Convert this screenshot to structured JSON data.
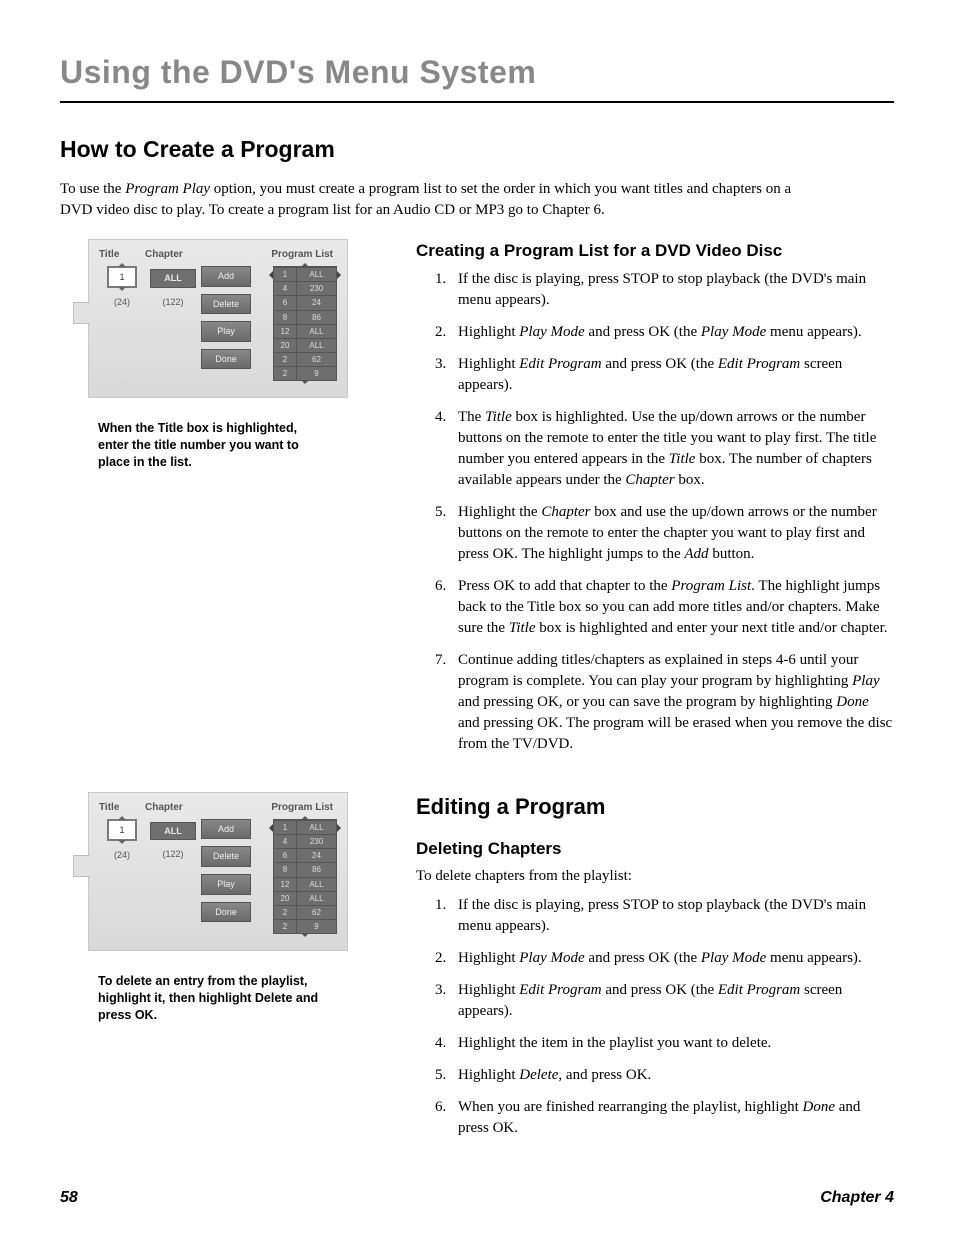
{
  "chapter_header": "Using the DVD's Menu System",
  "section1": {
    "heading": "How to Create a Program",
    "intro_parts": {
      "p1": "To use the ",
      "i1": "Program Play",
      "p2": " option, you must create a program list to set the order in which you want titles and chapters on a DVD video disc to play. To create a program list for an Audio CD or MP3 go to Chapter 6."
    },
    "screenshot": {
      "labels": {
        "title": "Title",
        "chapter": "Chapter",
        "program_list": "Program List"
      },
      "title_value": "1",
      "title_count": "(24)",
      "chapter_chip": "ALL",
      "chapter_count": "(122)",
      "buttons": [
        "Add",
        "Delete",
        "Play",
        "Done"
      ],
      "rows": [
        {
          "a": "1",
          "b": "ALL"
        },
        {
          "a": "4",
          "b": "230"
        },
        {
          "a": "6",
          "b": "24"
        },
        {
          "a": "8",
          "b": "86"
        },
        {
          "a": "12",
          "b": "ALL"
        },
        {
          "a": "20",
          "b": "ALL"
        },
        {
          "a": "2",
          "b": "62"
        },
        {
          "a": "2",
          "b": "9"
        }
      ]
    },
    "caption": "When the Title box is highlighted, enter the title number you want to place in the list.",
    "subhead": "Creating a Program List for a DVD Video Disc",
    "steps": [
      {
        "segs": [
          {
            "t": "If the disc is playing, press STOP to stop playback (the DVD's main menu appears)."
          }
        ]
      },
      {
        "segs": [
          {
            "t": "Highlight "
          },
          {
            "t": "Play Mode",
            "i": true
          },
          {
            "t": " and press OK (the "
          },
          {
            "t": "Play Mode",
            "i": true
          },
          {
            "t": " menu appears)."
          }
        ]
      },
      {
        "segs": [
          {
            "t": "Highlight "
          },
          {
            "t": "Edit Program",
            "i": true
          },
          {
            "t": " and press OK (the "
          },
          {
            "t": "Edit Program",
            "i": true
          },
          {
            "t": " screen appears)."
          }
        ]
      },
      {
        "segs": [
          {
            "t": "The "
          },
          {
            "t": "Title",
            "i": true
          },
          {
            "t": " box is highlighted. Use the up/down arrows or the number buttons on the remote to enter the title you want to play first. The title number you entered appears in the "
          },
          {
            "t": "Title",
            "i": true
          },
          {
            "t": " box. The number of chapters available appears under the "
          },
          {
            "t": "Chapter",
            "i": true
          },
          {
            "t": " box."
          }
        ]
      },
      {
        "segs": [
          {
            "t": "Highlight the "
          },
          {
            "t": "Chapter",
            "i": true
          },
          {
            "t": " box and use the up/down arrows or the number buttons on the remote to enter the chapter you want to play first and press OK. The highlight jumps to the "
          },
          {
            "t": "Add",
            "i": true
          },
          {
            "t": " button."
          }
        ]
      },
      {
        "segs": [
          {
            "t": "Press OK to add that chapter to the "
          },
          {
            "t": "Program List",
            "i": true
          },
          {
            "t": ". The highlight jumps back to the Title box so you can add more titles and/or chapters. Make sure the "
          },
          {
            "t": "Title",
            "i": true
          },
          {
            "t": " box is highlighted and enter your next title and/or chapter."
          }
        ]
      },
      {
        "segs": [
          {
            "t": "Continue adding titles/chapters as explained in steps 4-6 until your program is complete. You can play your program by highlighting "
          },
          {
            "t": "Play",
            "i": true
          },
          {
            "t": " and pressing OK, or you can save the program by highlighting "
          },
          {
            "t": "Done",
            "i": true
          },
          {
            "t": " and pressing OK. The program will be erased when you remove the disc from the TV/DVD."
          }
        ]
      }
    ]
  },
  "section2": {
    "heading": "Editing a Program",
    "caption": "To delete an entry from the playlist, highlight it, then highlight Delete and press OK.",
    "subhead": "Deleting Chapters",
    "lead": "To delete chapters from the playlist:",
    "steps": [
      {
        "segs": [
          {
            "t": "If the disc is playing, press STOP to stop playback (the DVD's main menu appears)."
          }
        ]
      },
      {
        "segs": [
          {
            "t": "Highlight "
          },
          {
            "t": "Play Mode",
            "i": true
          },
          {
            "t": " and press OK (the "
          },
          {
            "t": "Play Mode",
            "i": true
          },
          {
            "t": " menu appears)."
          }
        ]
      },
      {
        "segs": [
          {
            "t": "Highlight "
          },
          {
            "t": "Edit Program",
            "i": true
          },
          {
            "t": " and press OK (the "
          },
          {
            "t": "Edit Program",
            "i": true
          },
          {
            "t": " screen appears)."
          }
        ]
      },
      {
        "segs": [
          {
            "t": "Highlight the item in the playlist you want to delete."
          }
        ]
      },
      {
        "segs": [
          {
            "t": "Highlight "
          },
          {
            "t": "Delete",
            "i": true
          },
          {
            "t": ", and press OK."
          }
        ]
      },
      {
        "segs": [
          {
            "t": "When you are finished rearranging the playlist, highlight "
          },
          {
            "t": "Done",
            "i": true
          },
          {
            "t": " and press OK."
          }
        ]
      }
    ]
  },
  "footer": {
    "page": "58",
    "chapter": "Chapter 4"
  }
}
